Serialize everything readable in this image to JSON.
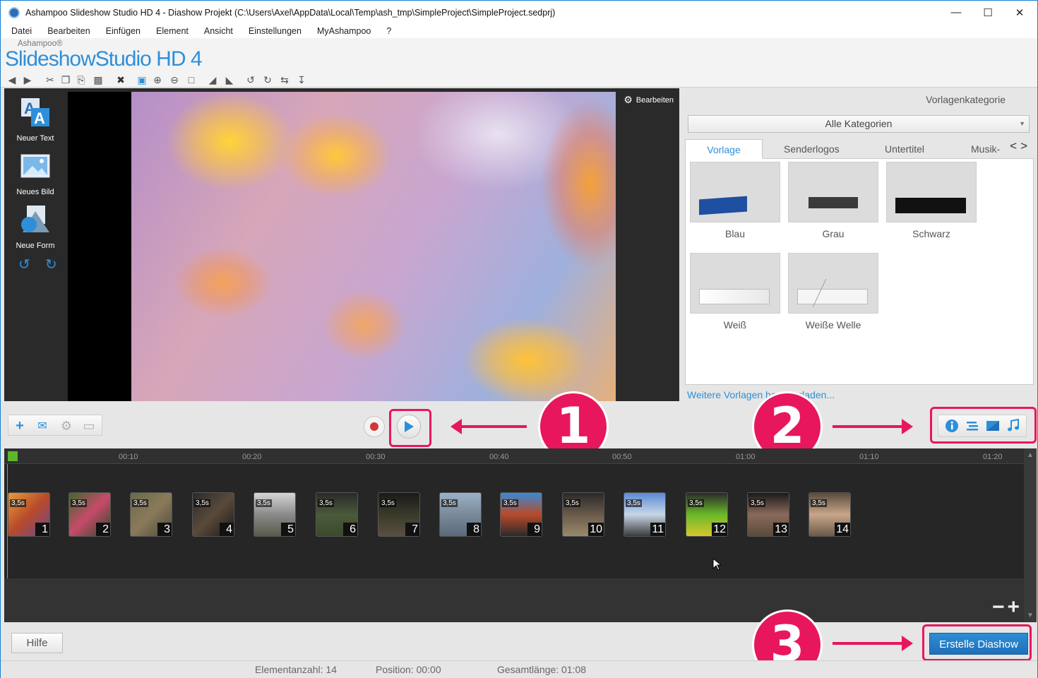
{
  "window": {
    "title": "Ashampoo Slideshow Studio HD 4 - Diashow Projekt (C:\\Users\\Axel\\AppData\\Local\\Temp\\ash_tmp\\SimpleProject\\SimpleProject.sedprj)",
    "controls": [
      "minimize-icon",
      "maximize-icon",
      "close-icon"
    ]
  },
  "menu": [
    "Datei",
    "Bearbeiten",
    "Einfügen",
    "Element",
    "Ansicht",
    "Einstellungen",
    "MyAshampoo",
    "?"
  ],
  "logo": {
    "brand": "Ashampoo®",
    "product": "SlideshowStudio",
    "version": "HD 4"
  },
  "toolbar": {
    "icons": [
      "undo-icon",
      "redo-icon",
      "cut-icon",
      "copy-icon",
      "paste-icon",
      "duplicate-icon",
      "delete-icon",
      "zoom-fit-icon",
      "zoom-in-icon",
      "zoom-out-icon",
      "zoom-reset-icon",
      "bring-forward-icon",
      "send-backward-icon",
      "rotate-left-icon",
      "rotate-right-icon",
      "flip-icon",
      "align-icon"
    ]
  },
  "tools": {
    "new_text": "Neuer Text",
    "new_image": "Neues Bild",
    "new_shape": "Neue Form"
  },
  "preview": {
    "edit_label": "Bearbeiten"
  },
  "templates": {
    "category_title": "Vorlagenkategorie",
    "category_selected": "Alle Kategorien",
    "tabs": [
      "Vorlage",
      "Senderlogos",
      "Untertitel",
      "Musik-"
    ],
    "active_tab": "Vorlage",
    "items": [
      "Blau",
      "Grau",
      "Schwarz",
      "Weiß",
      "Weiße Welle"
    ],
    "more_link": "Weitere Vorlagen herunterladen..."
  },
  "annotations": [
    "1",
    "2",
    "3"
  ],
  "timeline": {
    "ticks": [
      "00:10",
      "00:20",
      "00:30",
      "00:40",
      "00:50",
      "01:00",
      "01:10",
      "01:20"
    ],
    "clips": [
      {
        "num": "1",
        "dur": "3,5s"
      },
      {
        "num": "2",
        "dur": "3,5s"
      },
      {
        "num": "3",
        "dur": "3,5s"
      },
      {
        "num": "4",
        "dur": "3,5s"
      },
      {
        "num": "5",
        "dur": "3,5s"
      },
      {
        "num": "6",
        "dur": "3,5s"
      },
      {
        "num": "7",
        "dur": "3,5s"
      },
      {
        "num": "8",
        "dur": "3,5s"
      },
      {
        "num": "9",
        "dur": "3,5s"
      },
      {
        "num": "10",
        "dur": "3,5s"
      },
      {
        "num": "11",
        "dur": "3,5s"
      },
      {
        "num": "12",
        "dur": "3,5s"
      },
      {
        "num": "13",
        "dur": "3,5s"
      },
      {
        "num": "14",
        "dur": "3,5s"
      }
    ]
  },
  "bottom": {
    "help": "Hilfe",
    "create": "Erstelle Diashow"
  },
  "status": {
    "count": "Elementanzahl: 14",
    "position": "Position: 00:00",
    "length": "Gesamtlänge: 01:08"
  }
}
